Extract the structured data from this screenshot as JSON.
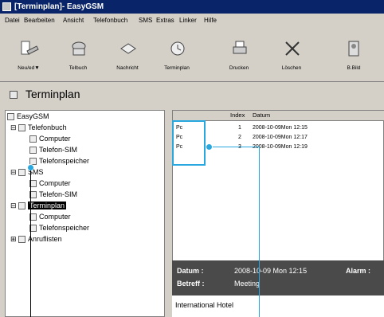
{
  "window": {
    "title": "[Terminplan]- EasyGSM"
  },
  "menu": [
    "Datei",
    "Bearbeiten",
    "Ansicht",
    "Telefonbuch",
    "SMS",
    "Extras",
    "Linker",
    "Hilfe"
  ],
  "toolbar": [
    {
      "label": "Neu/ed▼",
      "icon": "new-icon"
    },
    {
      "label": "Telbuch",
      "icon": "phonebook-icon"
    },
    {
      "label": "Nachricht",
      "icon": "message-icon"
    },
    {
      "label": "Terminplan",
      "icon": "calendar-icon"
    },
    {
      "label": "Drucken",
      "icon": "print-icon"
    },
    {
      "label": "Löschen",
      "icon": "delete-icon"
    },
    {
      "label": "B.Bild",
      "icon": "picture-icon"
    }
  ],
  "header": {
    "title": "Terminplan"
  },
  "tree": {
    "root": "EasyGSM",
    "telefonbuch": "Telefonbuch",
    "tb_computer": "Computer",
    "tb_sim": "Telefon-SIM",
    "tb_speicher": "Telefonspeicher",
    "sms": "SMS",
    "sms_computer": "Computer",
    "sms_sim": "Telefon-SIM",
    "terminplan": "Terminplan",
    "tp_computer": "Computer",
    "tp_speicher": "Telefonspeicher",
    "anruflisten": "Anruflisten"
  },
  "list": {
    "columns": [
      "",
      "Index",
      "Datum"
    ],
    "rows": [
      {
        "type": "Pc",
        "index": "1",
        "date": "2008-10-09Mon 12:15"
      },
      {
        "type": "Pc",
        "index": "2",
        "date": "2008-10-09Mon 12:17"
      },
      {
        "type": "Pc",
        "index": "3",
        "date": "2008-10-09Mon 12:19"
      }
    ]
  },
  "detail": {
    "datum_label": "Datum :",
    "datum_value": "2008-10-09 Mon 12:15",
    "alarm_label": "Alarm :",
    "betreff_label": "Betreff :",
    "betreff_value": "Meeting",
    "note": "International Hotel"
  },
  "colors": {
    "highlight": "#29a8e0",
    "titlebar": "#0a246a"
  }
}
